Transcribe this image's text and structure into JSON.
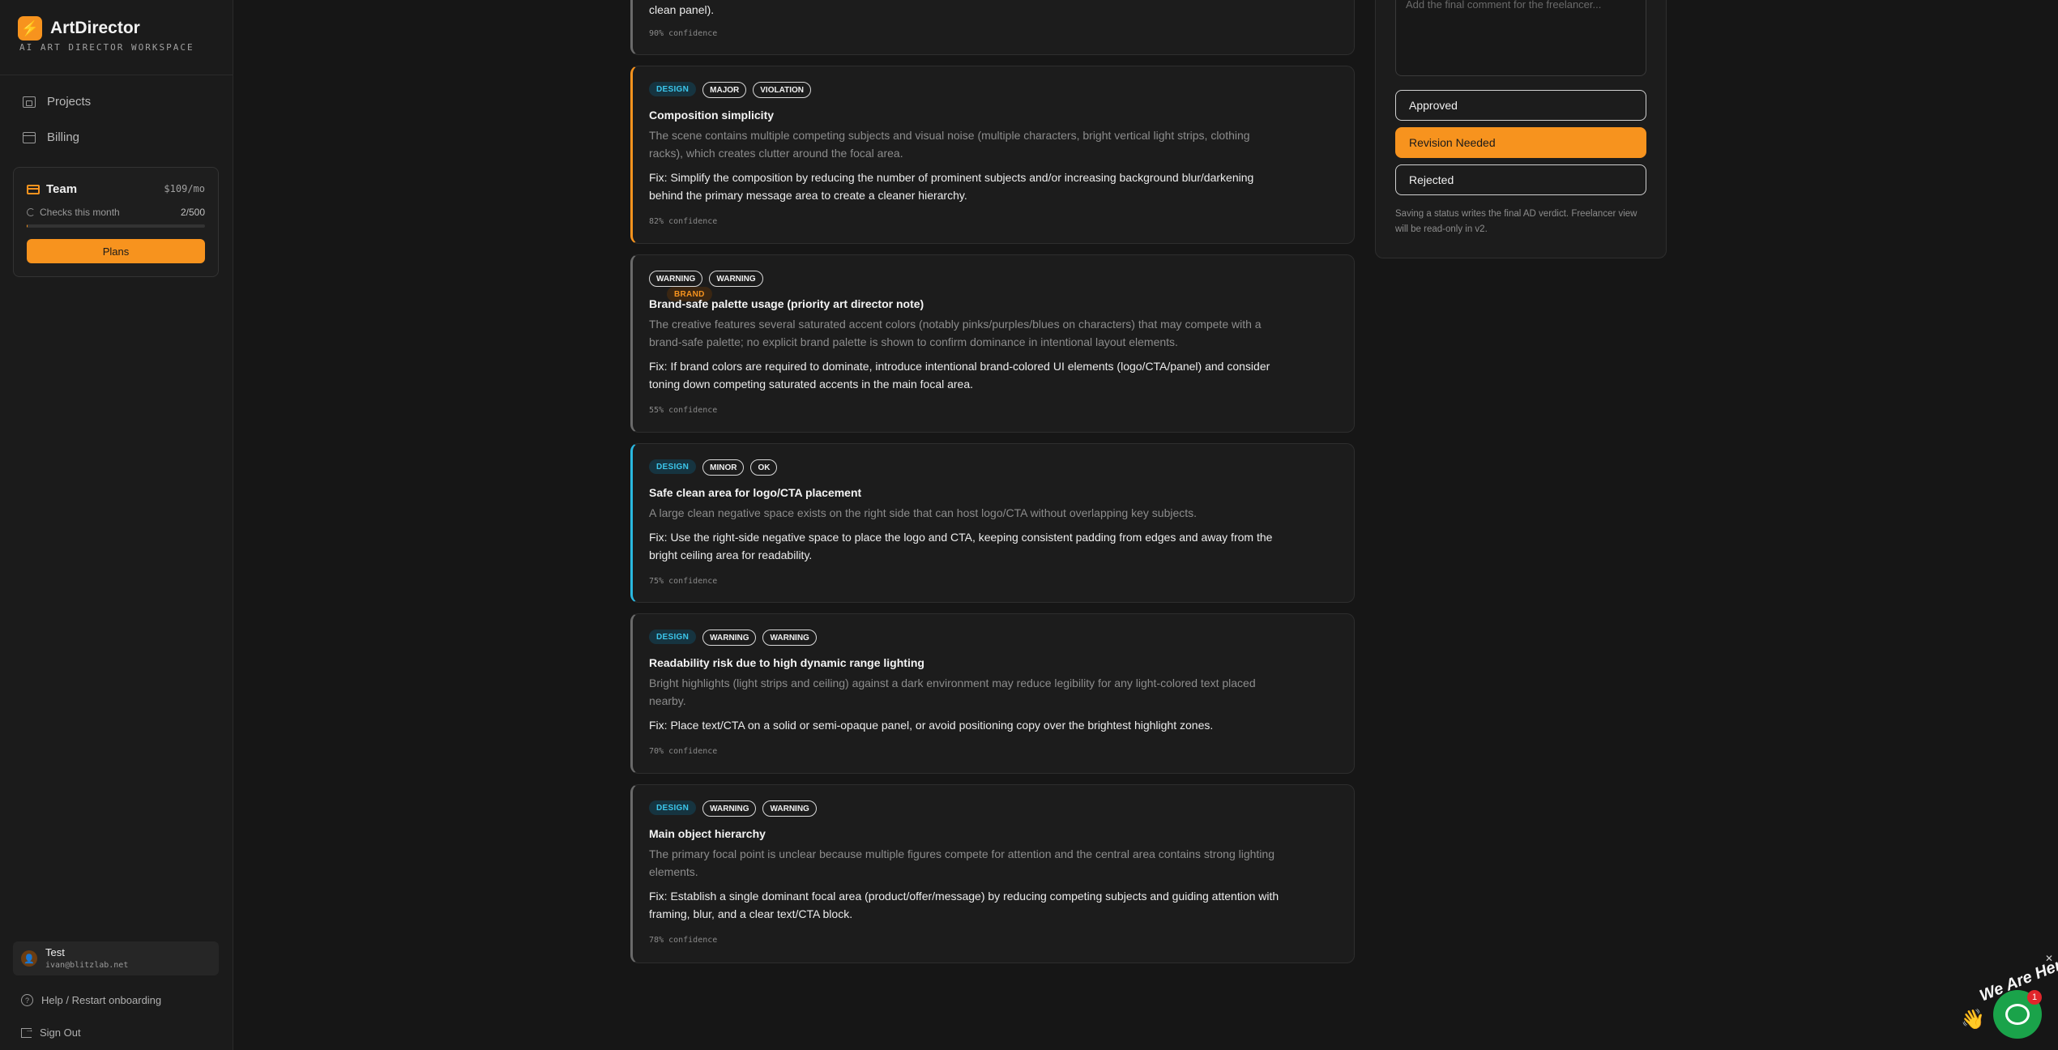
{
  "sidebar": {
    "brand_name": "ArtDirector",
    "brand_sub": "AI ART DIRECTOR WORKSPACE",
    "nav": [
      {
        "label": "Projects",
        "icon": "folder-icon"
      },
      {
        "label": "Billing",
        "icon": "card-icon"
      }
    ],
    "plan": {
      "name": "Team",
      "price": "$109/mo",
      "checks_label": "Checks this month",
      "checks_count": "2/500",
      "usage_fraction": 0.004,
      "button": "Plans"
    },
    "user": {
      "name": "Test",
      "email": "ivan@blitzlab.net"
    },
    "help_label": "Help / Restart onboarding",
    "signout_label": "Sign Out"
  },
  "issues": {
    "prev_tail": "clean panel).",
    "prev_confidence": "90% confidence",
    "items": [
      {
        "category": "DESIGN",
        "severity": "MAJOR",
        "status": "VIOLATION",
        "title": "Composition simplicity",
        "description": "The scene contains multiple competing subjects and visual noise (multiple characters, bright vertical light strips, clothing racks), which creates clutter around the focal area.",
        "fix": "Fix: Simplify the composition by reducing the number of prominent subjects and/or increasing background blur/darkening behind the primary message area to create a cleaner hierarchy.",
        "confidence": "82% confidence"
      },
      {
        "category": "BRAND",
        "severity": "WARNING",
        "status": "WARNING",
        "title": "Brand-safe palette usage (priority art director note)",
        "description": "The creative features several saturated accent colors (notably pinks/purples/blues on characters) that may compete with a brand-safe palette; no explicit brand palette is shown to confirm dominance in intentional layout elements.",
        "fix": "Fix: If brand colors are required to dominate, introduce intentional brand-colored UI elements (logo/CTA/panel) and consider toning down competing saturated accents in the main focal area.",
        "confidence": "55% confidence"
      },
      {
        "category": "DESIGN",
        "severity": "MINOR",
        "status": "OK",
        "title": "Safe clean area for logo/CTA placement",
        "description": "A large clean negative space exists on the right side that can host logo/CTA without overlapping key subjects.",
        "fix": "Fix: Use the right-side negative space to place the logo and CTA, keeping consistent padding from edges and away from the bright ceiling area for readability.",
        "confidence": "75% confidence"
      },
      {
        "category": "DESIGN",
        "severity": "WARNING",
        "status": "WARNING",
        "title": "Readability risk due to high dynamic range lighting",
        "description": "Bright highlights (light strips and ceiling) against a dark environment may reduce legibility for any light-colored text placed nearby.",
        "fix": "Fix: Place text/CTA on a solid or semi-opaque panel, or avoid positioning copy over the brightest highlight zones.",
        "confidence": "70% confidence"
      },
      {
        "category": "DESIGN",
        "severity": "WARNING",
        "status": "WARNING",
        "title": "Main object hierarchy",
        "description": "The primary focal point is unclear because multiple figures compete for attention and the central area contains strong lighting elements.",
        "fix": "Fix: Establish a single dominant focal area (product/offer/message) by reducing competing subjects and guiding attention with framing, blur, and a clear text/CTA block.",
        "confidence": "78% confidence"
      }
    ]
  },
  "verdict": {
    "comment_placeholder": "Add the final comment for the freelancer...",
    "buttons": [
      "Approved",
      "Revision Needed",
      "Rejected"
    ],
    "selected": "Revision Needed",
    "note": "Saving a status writes the final AD verdict. Freelancer view will be read-only in v2."
  },
  "chat": {
    "label": "We Are Here!",
    "badge": "1"
  },
  "colors": {
    "accent": "#f7931e",
    "design_tag": "#3cc7ec",
    "minor_border": "#2ab8e0",
    "chat_green": "#1aa34a"
  }
}
